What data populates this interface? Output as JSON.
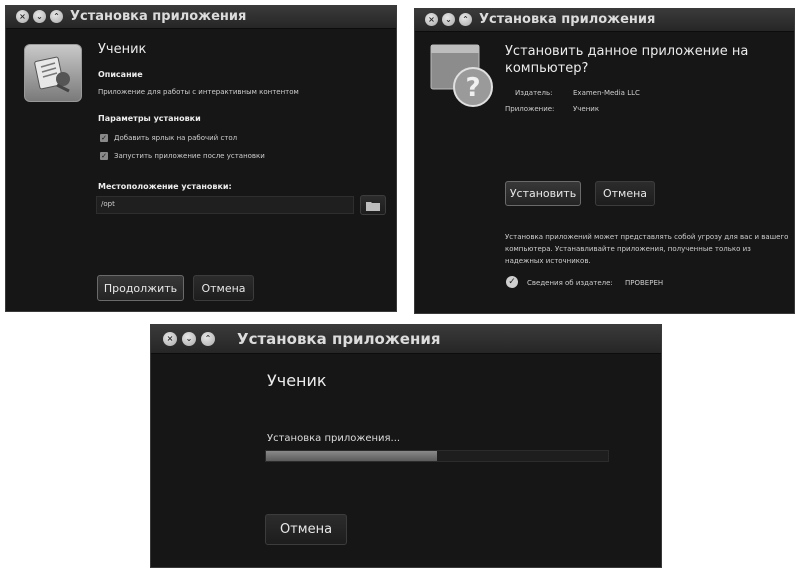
{
  "window1": {
    "title": "Установка приложения",
    "app_name": "Ученик",
    "description_heading": "Описание",
    "description_text": "Приложение для работы с интерактивным контентом",
    "params_heading": "Параметры установки",
    "option_shortcut": "Добавить ярлык на рабочий стол",
    "option_launch": "Запустить приложение после установки",
    "location_heading": "Местоположение установки:",
    "location_value": "/opt",
    "continue_label": "Продолжить",
    "cancel_label": "Отмена"
  },
  "window2": {
    "title": "Установка приложения",
    "question": "Установить данное приложение на компьютер?",
    "publisher_label": "Издатель:",
    "publisher_value": "Examen-Media LLC",
    "app_label": "Приложение:",
    "app_value": "Ученик",
    "install_label": "Установить",
    "cancel_label": "Отмена",
    "warning_text": "Установка приложений может представлять собой угрозу для вас и вашего компьютера. Устанавливайте приложения, полученные только из надежных источников.",
    "publisher_info_label": "Сведения об издателе:",
    "publisher_info_value": "ПРОВЕРЕН"
  },
  "window3": {
    "title": "Установка приложения",
    "app_name": "Ученик",
    "status_text": "Установка приложения...",
    "progress": 0.5,
    "cancel_label": "Отмена"
  },
  "icons": {
    "window_buttons": [
      "close-icon",
      "minimize-icon",
      "maximize-icon"
    ],
    "app_icon": "app-icon",
    "folder_icon": "folder-icon",
    "question_icon": "question-icon",
    "check_icon": "check-circle-icon"
  },
  "colors": {
    "window_bg": "#161616",
    "titlebar": "#2e2e2e",
    "text": "#e6e6e6",
    "progress_fill": "#6e6e6e"
  }
}
